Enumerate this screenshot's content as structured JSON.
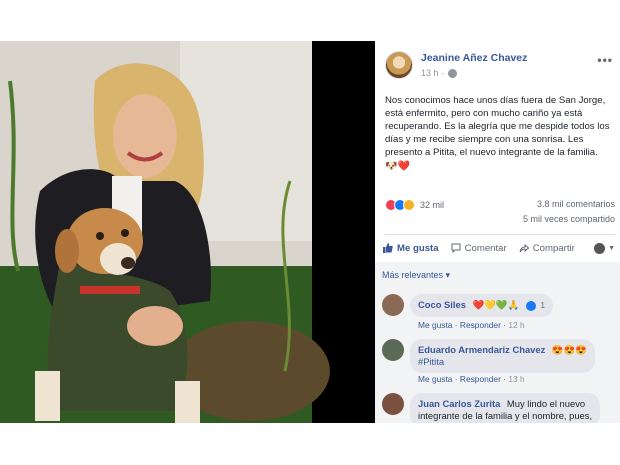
{
  "post": {
    "author": "Jeanine Añez Chavez",
    "time": "13 h",
    "more": "•••",
    "text_lines": [
      "Nos conocimos hace unos días fuera de San Jorge,",
      "está enfermito, pero con mucho cariño ya está",
      "recuperando. Es la alegría que me despide todos los",
      "días y me recibe siempre con una sonrisa. Les",
      "presento a Pitita, el nuevo integrante de la familia."
    ],
    "emoji_line": "🐶❤️"
  },
  "stats": {
    "reaction_count": "32 mil",
    "comments": "3.8 mil comentarios",
    "shares": "5 mil veces compartido"
  },
  "actions": {
    "like": "Me gusta",
    "comment": "Comentar",
    "share": "Compartir"
  },
  "comments": {
    "sort_label": "Más relevantes ▾",
    "items": [
      {
        "name": "Coco Siles",
        "text": "❤️💛💚🙏",
        "reply_count": "1",
        "like_label": "Me gusta",
        "reply_label": "Responder",
        "time": "12 h"
      },
      {
        "name": "Eduardo Armendariz Chavez",
        "text": "😍😍😍",
        "hashtag": "#Pitita",
        "like_label": "Me gusta",
        "reply_label": "Responder",
        "time": "13 h"
      },
      {
        "name": "Juan Carlos Zurita",
        "text_line1": "Muy lindo el nuevo",
        "text_line2": "integrante de la familia y el nombre, pues,"
      }
    ]
  },
  "colors": {
    "link": "#385898",
    "love": "#f33e58",
    "like": "#1877f2",
    "comment_bg": "#f2f3f5"
  }
}
